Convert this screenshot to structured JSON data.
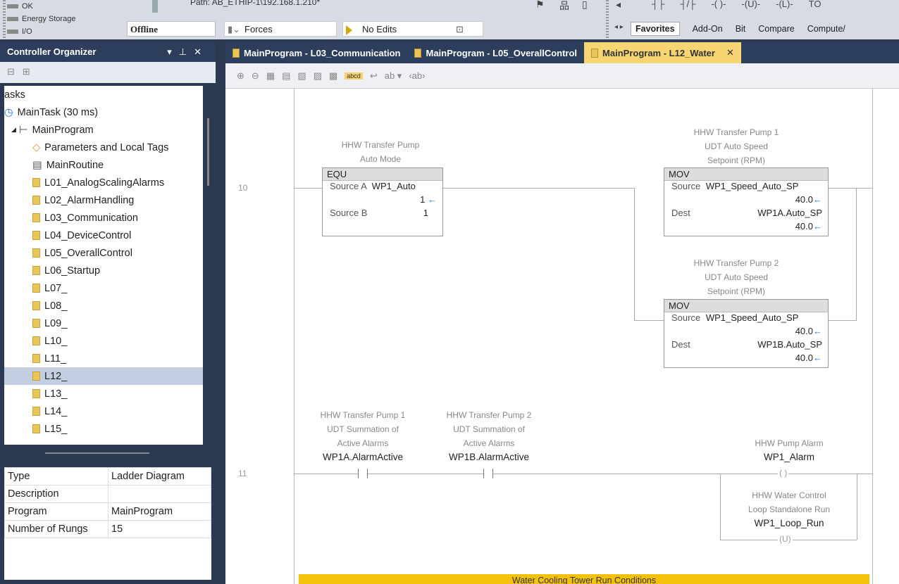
{
  "top": {
    "status_items": [
      "OK",
      "Energy Storage",
      "I/O"
    ],
    "path_label": "Path:",
    "path_value": "AB_ETHIP-1\\192.168.1.210*",
    "mode": "Offline",
    "forces": "Forces",
    "edits": "No Edits",
    "instr_tabs": [
      "Favorites",
      "Add-On",
      "Bit",
      "Compare",
      "Compute/"
    ],
    "ladder_icons": [
      "┤├",
      "┤/├",
      "-( )-",
      "-(U)-",
      "-(L)-",
      "TO"
    ]
  },
  "organizer": {
    "title": "Controller Organizer",
    "tree": [
      {
        "label": "asks",
        "icon": ""
      },
      {
        "label": "MainTask (30 ms)",
        "icon": "task"
      },
      {
        "label": "MainProgram",
        "icon": "program"
      },
      {
        "label": "Parameters and Local Tags",
        "icon": "tag"
      },
      {
        "label": "MainRoutine",
        "icon": "routine"
      },
      {
        "label": "L01_AnalogScalingAlarms",
        "icon": "ladder"
      },
      {
        "label": "L02_AlarmHandling",
        "icon": "ladder"
      },
      {
        "label": "L03_Communication",
        "icon": "ladder"
      },
      {
        "label": "L04_DeviceControl",
        "icon": "ladder"
      },
      {
        "label": "L05_OverallControl",
        "icon": "ladder"
      },
      {
        "label": "L06_Startup",
        "icon": "ladder"
      },
      {
        "label": "L07_",
        "icon": "ladder"
      },
      {
        "label": "L08_",
        "icon": "ladder"
      },
      {
        "label": "L09_",
        "icon": "ladder"
      },
      {
        "label": "L10_",
        "icon": "ladder"
      },
      {
        "label": "L11_",
        "icon": "ladder"
      },
      {
        "label": "L12_",
        "icon": "ladder"
      },
      {
        "label": "L13_",
        "icon": "ladder"
      },
      {
        "label": "L14_",
        "icon": "ladder"
      },
      {
        "label": "L15_",
        "icon": "ladder"
      }
    ],
    "props": [
      [
        "Type",
        "Ladder Diagram"
      ],
      [
        "Description",
        ""
      ],
      [
        "Program",
        "MainProgram"
      ],
      [
        "Number of Rungs",
        "15"
      ]
    ]
  },
  "doc_tabs": [
    "MainProgram - L03_Communication",
    "MainProgram - L05_OverallControl",
    "MainProgram - L12_Water"
  ],
  "editor": {
    "rung10": {
      "num": "10",
      "equ_comment": "HHW Transfer Pump\nAuto Mode",
      "equ": {
        "title": "EQU",
        "srcA_label": "Source A",
        "srcA_tag": "WP1_Auto",
        "srcA_val": "1",
        "srcB_label": "Source B",
        "srcB_val": "1"
      },
      "mov1_comment": "HHW Transfer Pump 1\nUDT Auto Speed\nSetpoint (RPM)",
      "mov1": {
        "title": "MOV",
        "src_label": "Source",
        "src_tag": "WP1_Speed_Auto_SP",
        "src_val": "40.0",
        "dest_label": "Dest",
        "dest_tag": "WP1A.Auto_SP",
        "dest_val": "40.0"
      },
      "mov2_comment": "HHW Transfer Pump 2\nUDT Auto Speed\nSetpoint (RPM)",
      "mov2": {
        "title": "MOV",
        "src_label": "Source",
        "src_tag": "WP1_Speed_Auto_SP",
        "src_val": "40.0",
        "dest_label": "Dest",
        "dest_tag": "WP1B.Auto_SP",
        "dest_val": "40.0"
      }
    },
    "rung11": {
      "num": "11",
      "c1_comment": "HHW Transfer Pump 1\nUDT Summation of\nActive Alarms",
      "c1_tag": "WP1A.AlarmActive",
      "c2_comment": "HHW Transfer Pump 2\nUDT Summation of\nActive Alarms",
      "c2_tag": "WP1B.AlarmActive",
      "coil1_comment": "HHW Pump Alarm",
      "coil1_tag": "WP1_Alarm",
      "coil2_comment": "HHW Water Control\nLoop Standalone Run",
      "coil2_tag": "WP1_Loop_Run",
      "coil1_sym": "( )",
      "coil2_sym": "(U)"
    },
    "banner": "Water Cooling Tower Run Conditions"
  }
}
